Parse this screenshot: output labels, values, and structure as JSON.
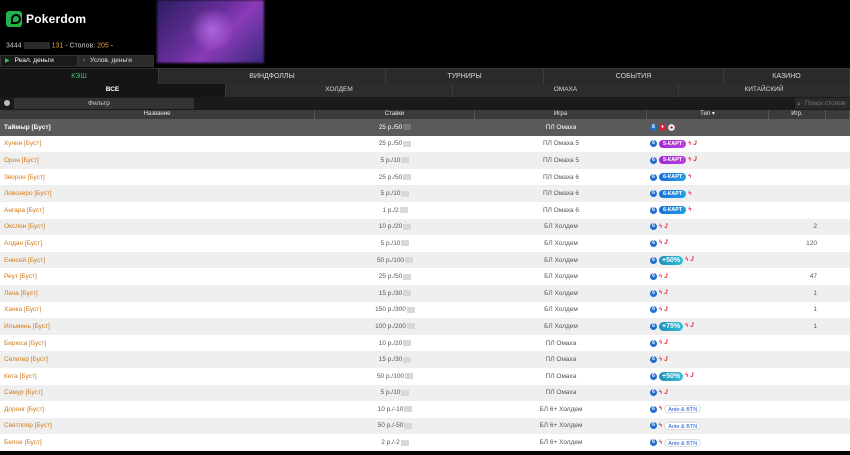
{
  "header": {
    "brand": "Pokerdom",
    "account_id": "3444",
    "account_num": "131",
    "tables_label": "- Столов:",
    "tables_count": "205",
    "tables_suffix": "-",
    "real_money": "Реал. деньги",
    "play_money": "Услов. деньги"
  },
  "main_tabs": [
    "КЭШ",
    "ВИНДФОЛЛЫ",
    "ТУРНИРЫ",
    "СОБЫТИЯ",
    "КАЗИНО"
  ],
  "sub_tabs": [
    "ВСЕ",
    "ХОЛДЕМ",
    "ОМАХА",
    "КИТАЙСКИЙ"
  ],
  "filter": {
    "label": "Фильтр",
    "search_placeholder": "Поиск столов"
  },
  "table": {
    "columns": [
      "Название",
      "Ставки",
      "Игра",
      "Тип ▾",
      "Игр."
    ],
    "rows": [
      {
        "name": "Таймыр [Буст]",
        "stake": "25 р./50",
        "game": "ПЛ Омаха",
        "type": "six-white-red",
        "players": "",
        "selected": true
      },
      {
        "name": "Хунин [Буст]",
        "stake": "25 р./50",
        "game": "ПЛ Омаха 5",
        "type": "5-КАРТ",
        "players": ""
      },
      {
        "name": "Орон [Буст]",
        "stake": "5 р./10",
        "game": "ПЛ Омаха 5",
        "type": "5-КАРТ",
        "players": ""
      },
      {
        "name": "Зворон [Буст]",
        "stake": "25 р./50",
        "game": "ПЛ Омаха 6",
        "type": "6-КАРТ",
        "players": ""
      },
      {
        "name": "Ловозеро [Буст]",
        "stake": "5 р./10",
        "game": "ПЛ Омаха 6",
        "type": "6-КАРТ",
        "players": ""
      },
      {
        "name": "Ангара [Буст]",
        "stake": "1 р./2",
        "game": "ПЛ Омаха 6",
        "type": "6-КАРТ",
        "players": ""
      },
      {
        "name": "Окслон [Буст]",
        "stake": "10 р./20",
        "game": "БЛ Холдем",
        "type": "six-bolt-j",
        "players": "2"
      },
      {
        "name": "Алдан [Буст]",
        "stake": "5 р./10",
        "game": "БЛ Холдем",
        "type": "six-bolt-j",
        "players": "120"
      },
      {
        "name": "Енисей [Буст]",
        "stake": "50 р./100",
        "game": "БЛ Холдем",
        "type": "+50%",
        "players": ""
      },
      {
        "name": "Реут [Буст]",
        "stake": "25 р./50",
        "game": "БЛ Холдем",
        "type": "six-bolt-j",
        "players": "47"
      },
      {
        "name": "Лача [Буст]",
        "stake": "15 р./30",
        "game": "БЛ Холдем",
        "type": "six-bolt-j",
        "players": "1"
      },
      {
        "name": "Ханка [Буст]",
        "stake": "150 р./300",
        "game": "БЛ Холдем",
        "type": "six-bolt-j",
        "players": "1"
      },
      {
        "name": "Ильмень [Буст]",
        "stake": "100 р./200",
        "game": "БЛ Холдем",
        "type": "+75%",
        "players": "1"
      },
      {
        "name": "Бирюса [Буст]",
        "stake": "10 р./20",
        "game": "ПЛ Омаха",
        "type": "six-bolt-j",
        "players": ""
      },
      {
        "name": "Селигер [Буст]",
        "stake": "15 р./30",
        "game": "ПЛ Омаха",
        "type": "six-bolt-j",
        "players": ""
      },
      {
        "name": "Кета [Буст]",
        "stake": "50 р./100",
        "game": "ПЛ Омаха",
        "type": "+50%",
        "players": ""
      },
      {
        "name": "Самур [Буст]",
        "stake": "5 р./10",
        "game": "ПЛ Омаха",
        "type": "six-bolt-j",
        "players": ""
      },
      {
        "name": "Доронг [Буст]",
        "stake": "10 р./-10",
        "game": "БЛ 6+ Холдем",
        "type": "Ante & BTN",
        "players": ""
      },
      {
        "name": "Светлояр [Буст]",
        "stake": "50 р./-50",
        "game": "БЛ 6+ Холдем",
        "type": "Ante & BTN",
        "players": ""
      },
      {
        "name": "Белое [Буст]",
        "stake": "2 р./-2",
        "game": "БЛ 6+ Холдем",
        "type": "Ante & BTN",
        "players": ""
      }
    ]
  },
  "colors": {
    "accent": "#3ac46a",
    "name_orange": "#d07a1a"
  }
}
